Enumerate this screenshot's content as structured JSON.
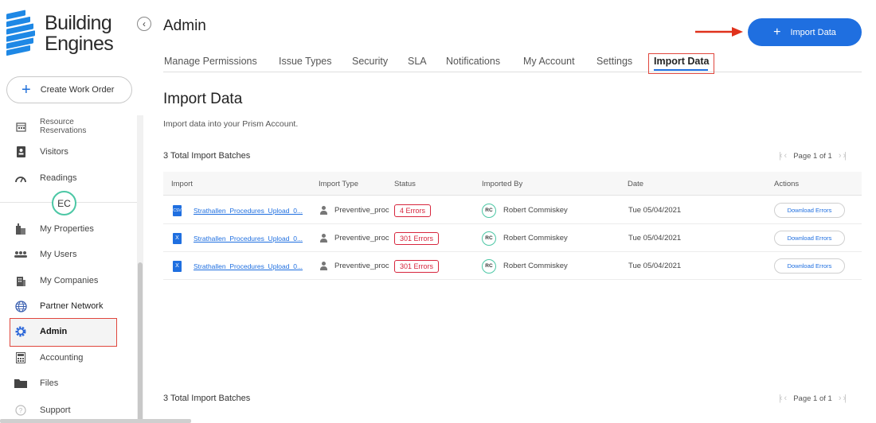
{
  "brand": {
    "line1": "Building",
    "line2": "Engines",
    "color": "#1e88e5"
  },
  "sidebar": {
    "create_label": "Create Work Order",
    "profile_initials": "EC",
    "items": [
      {
        "label": "Resource Reservations",
        "icon": "calendar-icon"
      },
      {
        "label": "Visitors",
        "icon": "badge-icon"
      },
      {
        "label": "Readings",
        "icon": "gauge-icon"
      },
      {
        "label": "My Properties",
        "icon": "building-icon"
      },
      {
        "label": "My Users",
        "icon": "users-icon"
      },
      {
        "label": "My Companies",
        "icon": "company-icon"
      },
      {
        "label": "Partner Network",
        "icon": "globe-icon"
      },
      {
        "label": "Admin",
        "icon": "gear-icon"
      },
      {
        "label": "Accounting",
        "icon": "calculator-icon"
      },
      {
        "label": "Files",
        "icon": "folder-icon"
      },
      {
        "label": "Support",
        "icon": "help-icon"
      }
    ]
  },
  "header": {
    "title": "Admin",
    "import_button": "Import Data",
    "accent": "#1f6fe0",
    "highlight": "#e0463d"
  },
  "tabs": [
    "Manage Permissions",
    "Issue Types",
    "Security",
    "SLA",
    "Notifications",
    "My Account",
    "Settings",
    "Import Data"
  ],
  "active_tab": "Import Data",
  "content": {
    "title": "Import Data",
    "subtitle": "Import data into your Prism Account.",
    "total_top": "3 Total Import Batches",
    "total_bottom": "3 Total Import Batches",
    "pager_text": "Page 1 of 1"
  },
  "table": {
    "columns": [
      "Import",
      "Import Type",
      "Status",
      "Imported By",
      "Date",
      "Actions"
    ],
    "rows": [
      {
        "file": "Strathallen_Procedures_Upload_0...",
        "file_icon": "CSV",
        "type": "Preventive_proc",
        "status": "4 Errors",
        "initials": "RC",
        "by": "Robert Commiskey",
        "date": "Tue 05/04/2021",
        "action": "Download Errors"
      },
      {
        "file": "Strathallen_Procedures_Upload_0...",
        "file_icon": "X",
        "type": "Preventive_proc",
        "status": "301 Errors",
        "initials": "RC",
        "by": "Robert Commiskey",
        "date": "Tue 05/04/2021",
        "action": "Download Errors"
      },
      {
        "file": "Strathallen_Procedures_Upload_0...",
        "file_icon": "X",
        "type": "Preventive_proc",
        "status": "301 Errors",
        "initials": "RC",
        "by": "Robert Commiskey",
        "date": "Tue 05/04/2021",
        "action": "Download Errors"
      }
    ]
  }
}
